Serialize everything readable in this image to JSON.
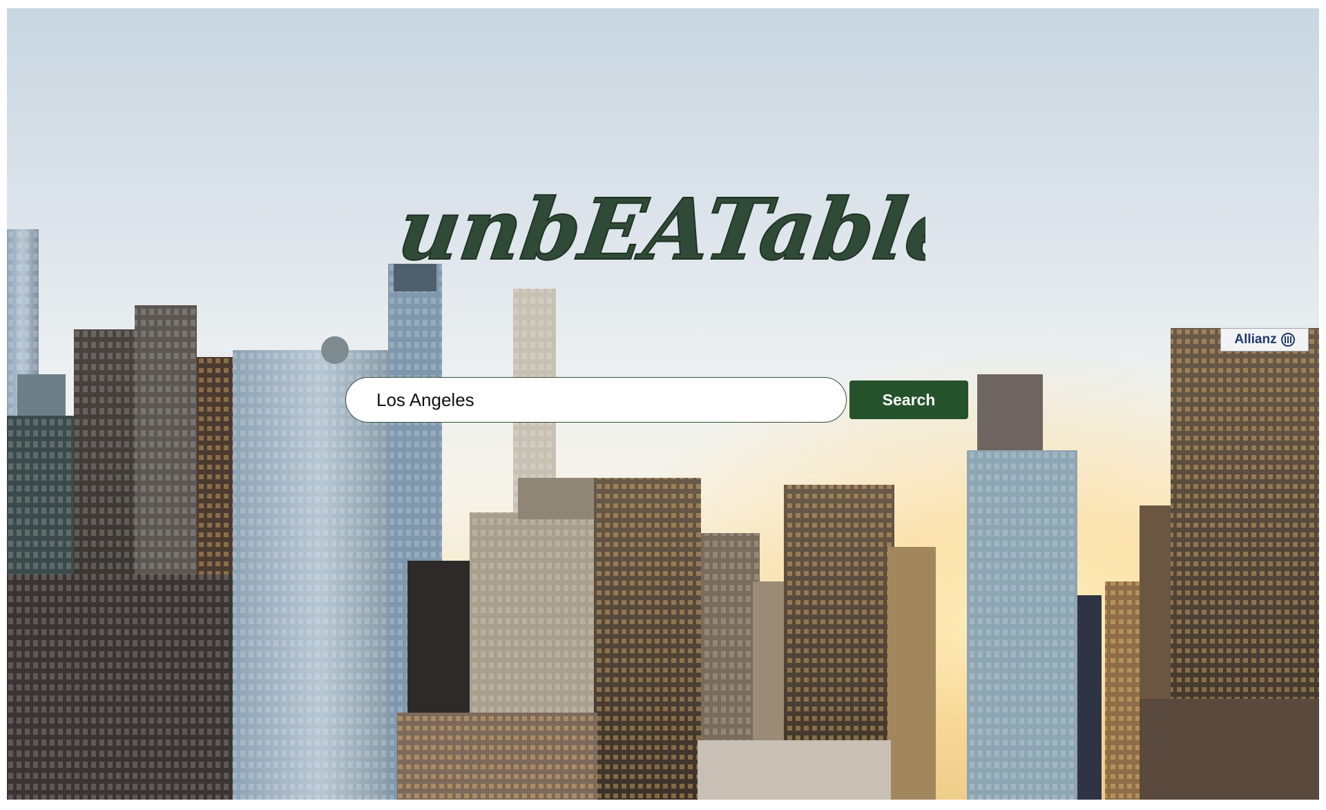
{
  "app": {
    "logo_text": "unbEATable"
  },
  "search": {
    "value": "Los Angeles",
    "button_label": "Search"
  },
  "background": {
    "sign_text": "Allianz"
  },
  "colors": {
    "brand_green": "#24532b",
    "logo_green": "#2f4a36",
    "input_border": "#2f4f34"
  },
  "icons": {
    "sign_mark": "allianz-logo-icon"
  }
}
